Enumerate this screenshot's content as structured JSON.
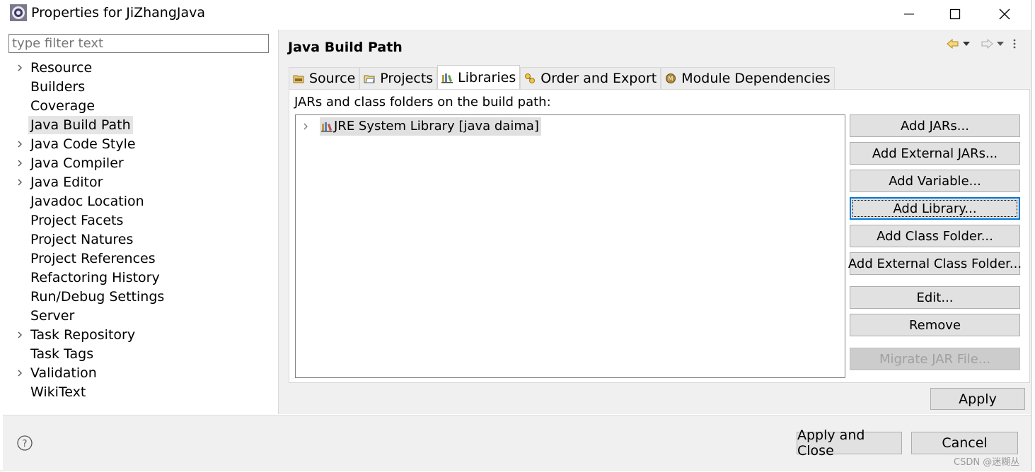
{
  "window": {
    "title": "Properties for JiZhangJava",
    "icons": {
      "app": "eclipse-gear-icon",
      "minimize": "minimize-icon",
      "maximize": "maximize-icon",
      "close": "close-icon"
    }
  },
  "sidebar": {
    "filter_placeholder": "type filter text",
    "items": [
      {
        "label": "Resource",
        "expandable": true
      },
      {
        "label": "Builders",
        "expandable": false
      },
      {
        "label": "Coverage",
        "expandable": false
      },
      {
        "label": "Java Build Path",
        "expandable": false,
        "selected": true
      },
      {
        "label": "Java Code Style",
        "expandable": true
      },
      {
        "label": "Java Compiler",
        "expandable": true
      },
      {
        "label": "Java Editor",
        "expandable": true
      },
      {
        "label": "Javadoc Location",
        "expandable": false
      },
      {
        "label": "Project Facets",
        "expandable": false
      },
      {
        "label": "Project Natures",
        "expandable": false
      },
      {
        "label": "Project References",
        "expandable": false
      },
      {
        "label": "Refactoring History",
        "expandable": false
      },
      {
        "label": "Run/Debug Settings",
        "expandable": false
      },
      {
        "label": "Server",
        "expandable": false
      },
      {
        "label": "Task Repository",
        "expandable": true
      },
      {
        "label": "Task Tags",
        "expandable": false
      },
      {
        "label": "Validation",
        "expandable": true
      },
      {
        "label": "WikiText",
        "expandable": false
      }
    ]
  },
  "main": {
    "title": "Java Build Path",
    "tabs": [
      {
        "label": "Source",
        "icon": "source-folder-icon"
      },
      {
        "label": "Projects",
        "icon": "projects-folder-icon"
      },
      {
        "label": "Libraries",
        "icon": "libraries-icon",
        "active": true
      },
      {
        "label": "Order and Export",
        "icon": "order-export-icon"
      },
      {
        "label": "Module Dependencies",
        "icon": "module-icon"
      }
    ],
    "libraries": {
      "heading": "JARs and class folders on the build path:",
      "entries": [
        {
          "label": "JRE System Library [java daima]",
          "icon": "library-icon"
        }
      ],
      "buttons": {
        "add_jars": "Add JARs...",
        "add_external_jars": "Add External JARs...",
        "add_variable": "Add Variable...",
        "add_library": "Add Library...",
        "add_class_folder": "Add Class Folder...",
        "add_external_class_folder": "Add External Class Folder...",
        "edit": "Edit...",
        "remove": "Remove",
        "migrate_jar": "Migrate JAR File..."
      }
    },
    "apply": "Apply"
  },
  "footer": {
    "apply_and_close": "Apply and Close",
    "cancel": "Cancel",
    "help_icon": "help-icon"
  },
  "watermark": "CSDN @迷糊丛"
}
